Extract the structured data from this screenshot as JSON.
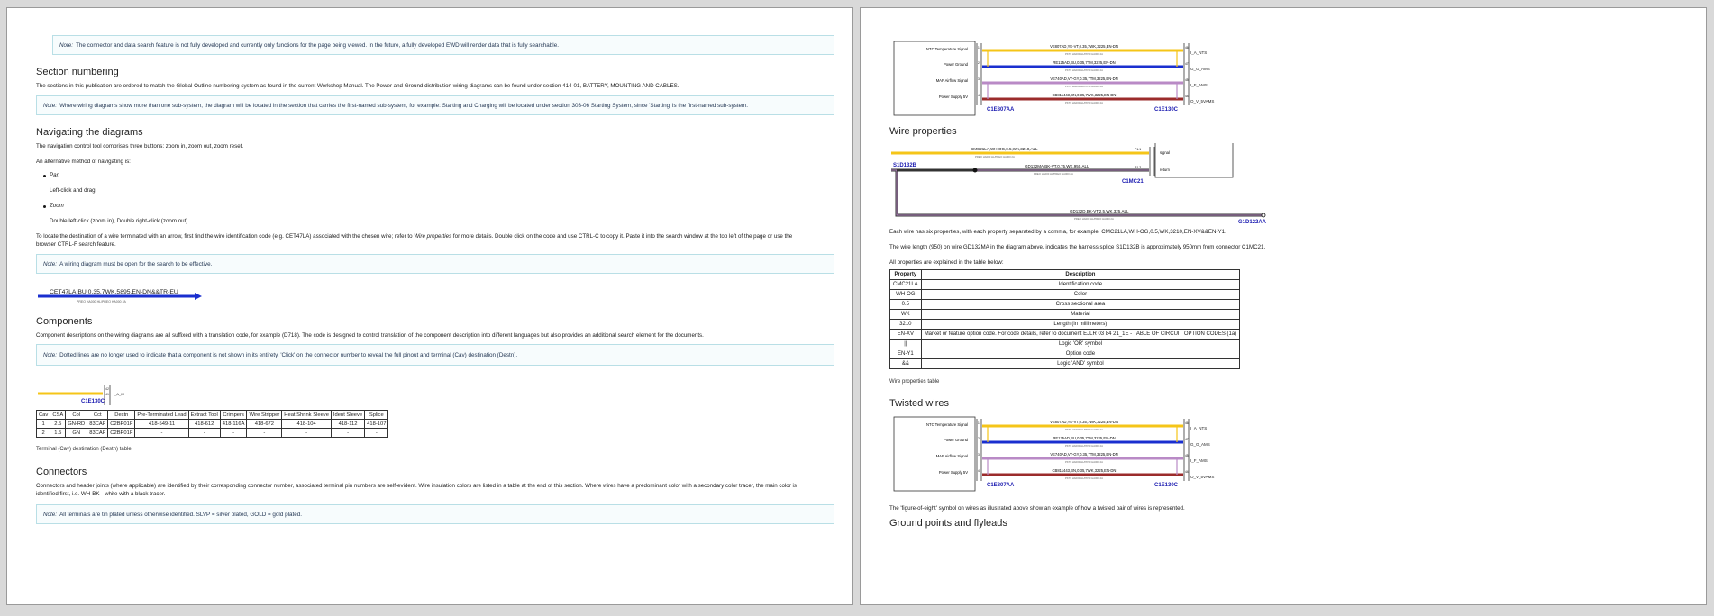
{
  "left": {
    "note_search": {
      "prefix": "Note:",
      "text": "The connector and data search feature is not fully developed and currently only functions for the page being viewed. In the future, a fully developed EWD will render data that is fully searchable."
    },
    "section_numbering": {
      "heading": "Section numbering",
      "body": "The sections in this publication are ordered to match the Global Outline numbering system as found in the current Workshop Manual. The Power and Ground distribution wiring diagrams can be found under section 414-01, BATTERY, MOUNTING AND CABLES.",
      "note_prefix": "Note:",
      "note": "Where wiring diagrams show more than one sub-system, the diagram will be located in the section that carries the first-named sub-system, for example: Starting and Charging will be located under section 303-06 Starting System, since 'Starting' is the first-named sub-system."
    },
    "navigating": {
      "heading": "Navigating the diagrams",
      "intro": "The navigation control tool comprises three buttons: zoom in, zoom out, zoom reset.",
      "alt": "An alternative method of navigating is:",
      "pan_label": "Pan",
      "pan_desc": "Left-click and drag",
      "zoom_label": "Zoom",
      "zoom_desc": "Double left-click (zoom in), Double right-click (zoom out)",
      "locate_1": "To locate the destination of a wire terminated with an arrow, first find the wire identification code (e.g. CET47LA) associated with the chosen wire; refer to",
      "locate_link": "Wire properties",
      "locate_2": "for more details. Double click on the code and use CTRL-C to copy it. Paste it into the search window at the top left of the page or use the",
      "locate_3": "browser CTRL-F search feature.",
      "note_prefix": "Note:",
      "note": "A wiring diagram must be open for the search to be effective.",
      "wire_label": "CET47LA,BU,0.35,7WK,5895,EN-DN&&TR-EU",
      "wire_sub": "PREO HA000 HL/PREO HA000 2A"
    },
    "components": {
      "heading": "Components",
      "body": "Component descriptions on the wiring diagrams are all suffixed with a translation code, for example (D718). The code is designed to control translation of the component description into different languages but also provides an additional search element for the documents.",
      "note_prefix": "Note:",
      "note": "Dotted lines are no longer used to indicate that a component is not shown in its entirety. 'Click' on the connector number to reveal the full pinout and terminal (Cav) destination (Destn).",
      "connector_id": "C1E130C",
      "pin_a": "42",
      "pin_b": "41",
      "wire_end_label": "I_A_IK",
      "table": {
        "headers": [
          "Cav",
          "CSA",
          "Col",
          "Cct",
          "Destn",
          "Pre-Terminated Lead",
          "Extract Tool",
          "Crimpers",
          "Wire Stripper",
          "Heat Shrink Sleeve",
          "Ident Sleeve",
          "Splice"
        ],
        "rows": [
          [
            "1",
            "2.5",
            "GN-RD",
            "83CAF",
            "C2BP01F",
            "418-549-11",
            "418-612",
            "418-116A",
            "418-672",
            "418-104",
            "418-112",
            "418-107"
          ],
          [
            "2",
            "1.5",
            "GN",
            "83CAF",
            "C2BP01F",
            "-",
            "-",
            "-",
            "-",
            "-",
            "-",
            "-"
          ]
        ]
      },
      "table_caption": "Terminal (Cav) destination (Destn) table"
    },
    "connectors": {
      "heading": "Connectors",
      "body_1": "Connectors and header joints (where applicable) are identified by their corresponding connector number, associated terminal pin numbers are self-evident. Wire insulation colors are listed in a table at the end of this section. Where wires have a predominant color with a secondary color tracer, the main color is",
      "body_2": "identified first, i.e. WH-BK - white with a black tracer.",
      "note_prefix": "Note:",
      "note": "All terminals are tin plated unless otherwise identified. SLVP = silver plated, GOLD = gold plated."
    }
  },
  "right": {
    "top_diagram": {
      "signals": [
        "NTC Temperature Signal",
        "Power Ground",
        "MAP Airflow Signal",
        "Power Supply 5V"
      ],
      "wires": [
        "VE807AD,YE-VT,0.35,7WK,3225,EN-DN",
        "RE125AD,BU,0.35,7TM,3225,EN-DN",
        "VE740AD,VT-GY,0.35,7TM,3225,EN-DN",
        "CB811443,BN,0.35,7WK,3225,EN-DN"
      ],
      "wire_sub": "PKT0 HA000 HL/PKT0 HA000 2A",
      "right_labels": [
        "I_A_NTS",
        "G_G_AMS",
        "I_F_AMS",
        "O_V_5VAMS"
      ],
      "left_pins": [
        "1",
        "2",
        "3",
        "4"
      ],
      "right_pins": [
        "46",
        "47",
        "45",
        "44"
      ],
      "left_conn": "C1E807AA",
      "right_conn": "C1E130C"
    },
    "wire_properties": {
      "heading": "Wire properties",
      "wire1": "CMC21LA,WH-OG,0.5,WK,3210,ALL",
      "wire1_sub": "PREO HA000 HL/PREO HA000 2A",
      "splice": "S1D132B",
      "wire2": "GD132MA,BK-VT,0.75,WK,950,ALL",
      "wire2_sub": "PREO HA000 HL/PREO HA000 2A",
      "wire3": "GD132D,BK-VT,2.5,WK,325,ALL",
      "wire3_sub": "PREO HA000 HL/PREO HA000 2A",
      "box_signal": "signal",
      "box_return": "return",
      "box_conn": "C1MC21",
      "pin_p1": "P1.1",
      "pin_p2": "P1.2",
      "ground_id": "G1D122AA",
      "para1": "Each wire has six properties, with each property separated by a comma, for example: CMC21LA,WH-OG,0.5,WK,3210,EN-XV&&EN-Y1.",
      "para2": "The wire length (950) on wire GD132MA in the diagram above, indicates the harness splice S1D132B is approximately 950mm from connector C1MC21.",
      "para3": "All properties are explained in the table below:",
      "table": {
        "headers": [
          "Property",
          "Description"
        ],
        "rows": [
          [
            "CMC21LA",
            "Identification code"
          ],
          [
            "WH-OG",
            "Color"
          ],
          [
            "0.5",
            "Cross sectional area"
          ],
          [
            "WK",
            "Material"
          ],
          [
            "3210",
            "Length (in millimeters)"
          ],
          [
            "EN-XV",
            "Market or feature option code. For code details, refer to document EJLR 03 84 21_1E - TABLE OF CIRCUIT OPTION CODES (1a)"
          ],
          [
            "||",
            "Logic 'OR' symbol"
          ],
          [
            "EN-Y1",
            "Option code"
          ],
          [
            "&&",
            "Logic 'AND' symbol"
          ]
        ]
      },
      "caption": "Wire properties table"
    },
    "twisted": {
      "heading": "Twisted wires",
      "para": "The 'figure-of-eight' symbol on wires as illustrated above show an example of how a twisted pair of wires is represented."
    },
    "ground": {
      "heading": "Ground points and flyleads"
    },
    "colors": {
      "yellow": "#f5c518",
      "blue": "#1a2fcf",
      "violet": "#b98ac6",
      "brown": "#9b2b2b",
      "link": "#1a1ab0",
      "note_border": "#b9dfe6"
    }
  }
}
